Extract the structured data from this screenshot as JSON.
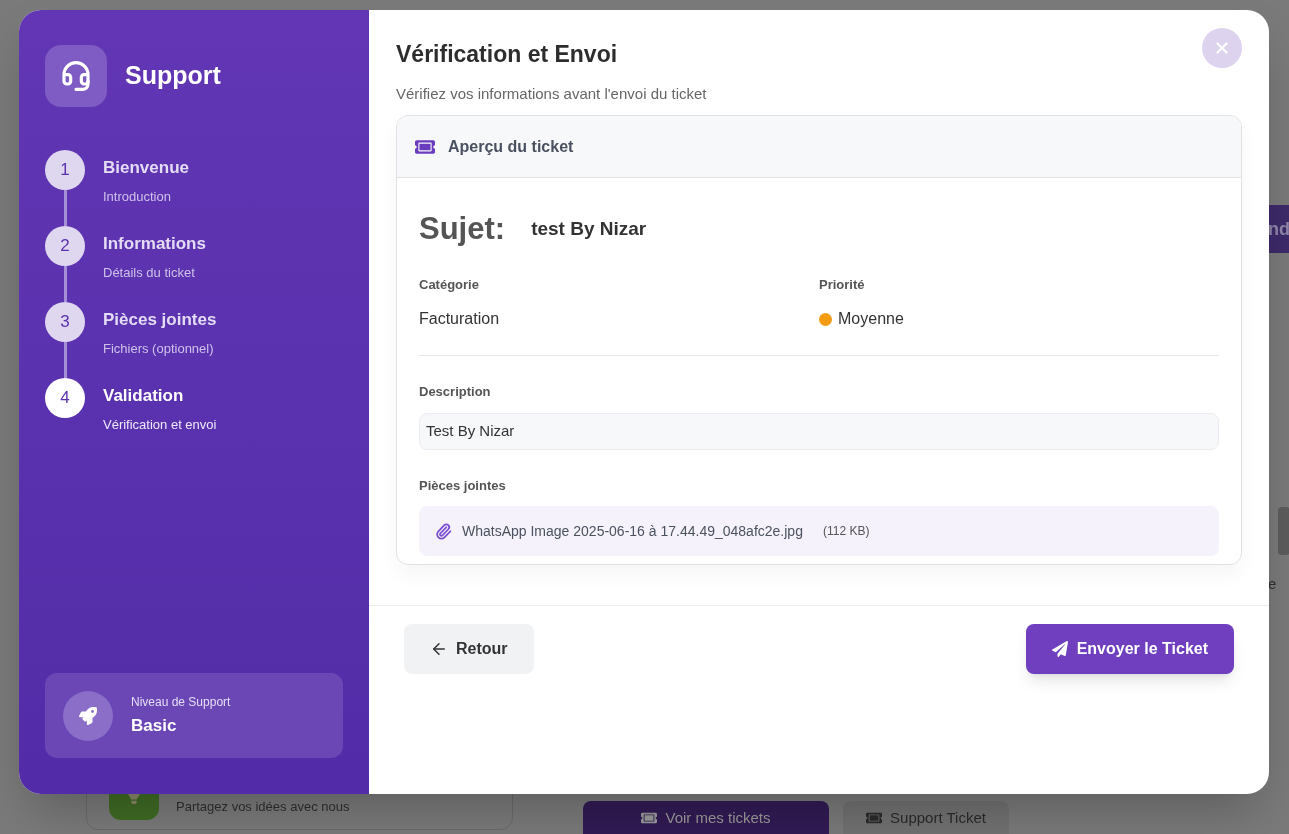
{
  "page_behind": {
    "banner_button": "nd",
    "side_text": "e",
    "card_text": "Partagez vos idées avec nous",
    "tabs": [
      {
        "label": "Voir mes tickets",
        "selected": true
      },
      {
        "label": "Support Ticket",
        "selected": false
      }
    ]
  },
  "sidebar": {
    "title": "Support",
    "steps": [
      {
        "number": "1",
        "title": "Bienvenue",
        "subtitle": "Introduction",
        "selected": false
      },
      {
        "number": "2",
        "title": "Informations",
        "subtitle": "Détails du ticket",
        "selected": false
      },
      {
        "number": "3",
        "title": "Pièces jointes",
        "subtitle": "Fichiers (optionnel)",
        "selected": false
      },
      {
        "number": "4",
        "title": "Validation",
        "subtitle": "Vérification et envoi",
        "selected": true
      }
    ],
    "support_level": {
      "label": "Niveau de Support",
      "value": "Basic"
    }
  },
  "main": {
    "title": "Vérification et Envoi",
    "subtitle": "Vérifiez vos informations avant l'envoi du ticket",
    "preview": {
      "header": "Aperçu du ticket",
      "subject_label": "Sujet:",
      "subject": "test By Nizar",
      "category_label": "Catégorie",
      "category": "Facturation",
      "priority_label": "Priorité",
      "priority": {
        "text": "Moyenne",
        "color": "#f39c12"
      },
      "description_label": "Description",
      "description": "Test By Nizar",
      "attachments_label": "Pièces jointes",
      "attachments": [
        {
          "name": "WhatsApp Image 2025-06-16 à 17.44.49_048afc2e.jpg",
          "size": "(112 KB)"
        }
      ]
    },
    "back_button": "Retour",
    "send_button": "Envoyer le Ticket"
  }
}
